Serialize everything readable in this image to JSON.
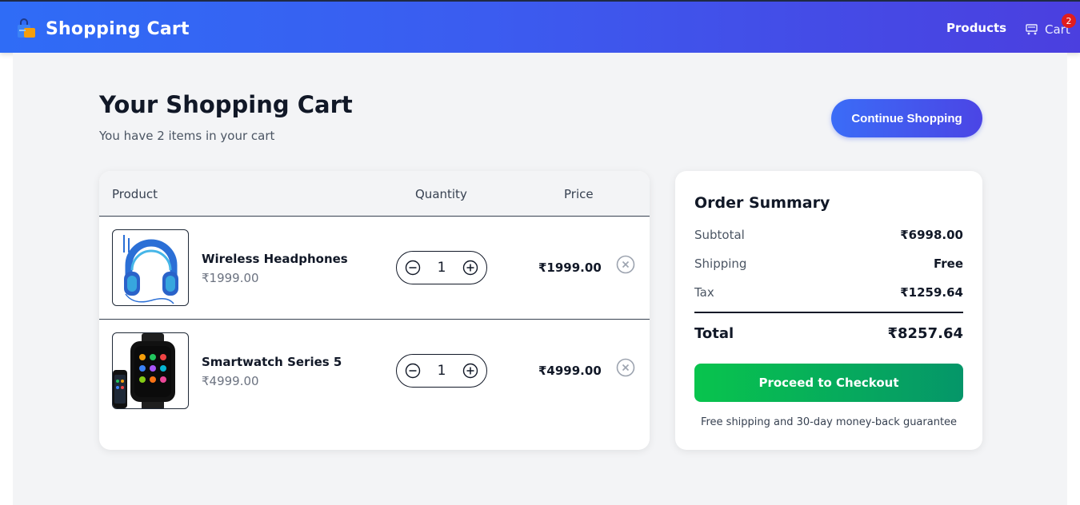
{
  "header": {
    "title": "Shopping Cart",
    "nav_products": "Products",
    "nav_cart": "Cart",
    "cart_count": "2",
    "brand_icon": "shopping-bag-icon",
    "cart_icon": "cart-icon"
  },
  "page": {
    "title": "Your Shopping Cart",
    "subtitle": "You have 2 items in your cart",
    "continue_label": "Continue Shopping"
  },
  "table": {
    "headers": {
      "product": "Product",
      "quantity": "Quantity",
      "price": "Price"
    },
    "items": [
      {
        "name": "Wireless Headphones",
        "unit_price": "₹1999.00",
        "quantity": "1",
        "price": "₹1999.00",
        "image": "headphones-image"
      },
      {
        "name": "Smartwatch Series 5",
        "unit_price": "₹4999.00",
        "quantity": "1",
        "price": "₹4999.00",
        "image": "smartwatch-image"
      }
    ]
  },
  "summary": {
    "title": "Order Summary",
    "subtotal_label": "Subtotal",
    "subtotal_value": "₹6998.00",
    "shipping_label": "Shipping",
    "shipping_value": "Free",
    "tax_label": "Tax",
    "tax_value": "₹1259.64",
    "total_label": "Total",
    "total_value": "₹8257.64",
    "checkout_label": "Proceed to Checkout",
    "guarantee": "Free shipping and 30-day money-back guarantee"
  },
  "colors": {
    "header_start": "#2f6cf6",
    "header_end": "#4b3fdf",
    "checkout_start": "#08c44d",
    "checkout_end": "#059669",
    "badge": "#e11d1d"
  }
}
